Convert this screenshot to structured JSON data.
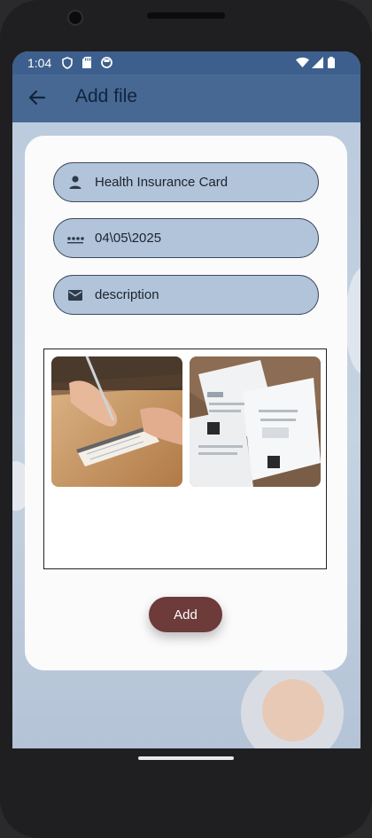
{
  "status_bar": {
    "time": "1:04",
    "icons": [
      "shield-icon",
      "sd-card-icon",
      "circle-app-icon",
      "wifi-icon",
      "cellular-icon",
      "battery-icon"
    ]
  },
  "app_bar": {
    "title": "Add file",
    "back_icon": "arrow-left-icon"
  },
  "form": {
    "name_field": {
      "icon": "person-icon",
      "value": "Health Insurance Card",
      "placeholder": ""
    },
    "date_field": {
      "icon": "password-dots-icon",
      "value": "04\\05\\2025",
      "placeholder": ""
    },
    "description_field": {
      "icon": "mail-icon",
      "value": "",
      "placeholder": "description"
    }
  },
  "gallery": {
    "images": [
      {
        "name": "image-writing-notebook"
      },
      {
        "name": "image-documents-paper-clips"
      }
    ]
  },
  "actions": {
    "add_label": "Add"
  },
  "colors": {
    "status_bar": "#3d5f8d",
    "app_bar": "#476893",
    "field_fill": "#b2c4d9",
    "add_button": "#6d3b3a",
    "card": "#fbfbfc"
  }
}
